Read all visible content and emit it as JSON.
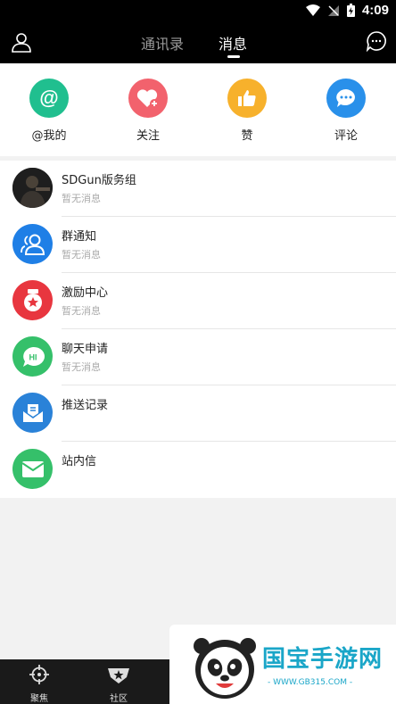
{
  "status_bar": {
    "time": "4:09"
  },
  "header": {
    "tabs": [
      {
        "label": "通讯录",
        "active": false
      },
      {
        "label": "消息",
        "active": true
      }
    ]
  },
  "quick_actions": [
    {
      "label": "@我的",
      "icon": "at-icon",
      "color": "#20bf8f"
    },
    {
      "label": "关注",
      "icon": "heart-plus-icon",
      "color": "#f2626d"
    },
    {
      "label": "赞",
      "icon": "thumbs-up-icon",
      "color": "#f7b12c"
    },
    {
      "label": "评论",
      "icon": "comment-bubble-icon",
      "color": "#2990ea"
    }
  ],
  "messages": [
    {
      "title": "SDGun版务组",
      "subtitle": "暂无消息",
      "icon": "group-photo-avatar"
    },
    {
      "title": "群通知",
      "subtitle": "暂无消息",
      "icon": "group-users-icon",
      "color": "#1f7fe6"
    },
    {
      "title": "激励中心",
      "subtitle": "暂无消息",
      "icon": "medal-icon",
      "color": "#e8363f"
    },
    {
      "title": "聊天申请",
      "subtitle": "暂无消息",
      "icon": "chat-hi-icon",
      "color": "#35c06a"
    },
    {
      "title": "推送记录",
      "subtitle": "",
      "icon": "inbox-push-icon",
      "color": "#2a82d8"
    },
    {
      "title": "站内信",
      "subtitle": "",
      "icon": "envelope-icon",
      "color": "#35c06a"
    }
  ],
  "bottom_nav": [
    {
      "label": "聚焦",
      "icon": "crosshair-icon"
    },
    {
      "label": "社区",
      "icon": "star-badge-icon"
    }
  ],
  "watermark": {
    "text": "国宝手游网",
    "url": "- WWW.GB315.COM -"
  }
}
